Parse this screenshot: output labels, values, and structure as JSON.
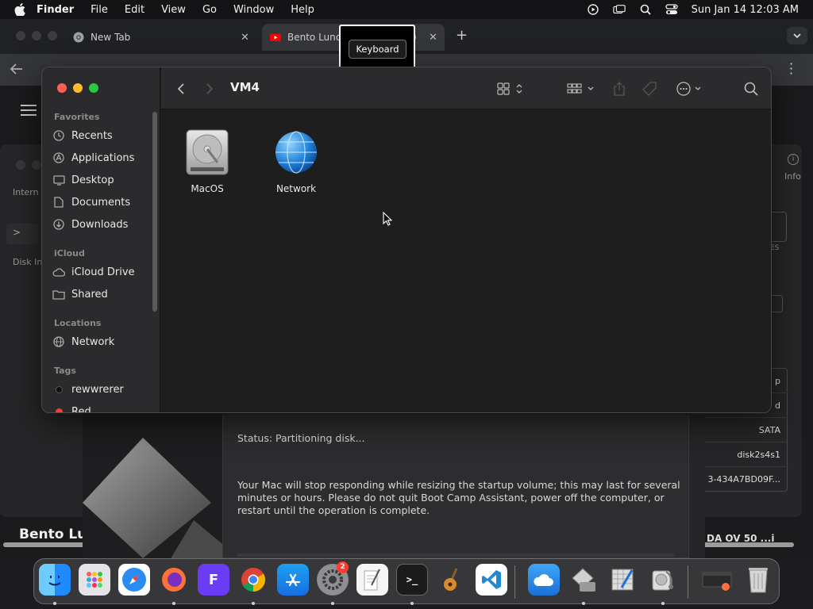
{
  "menubar": {
    "app": "Finder",
    "items": [
      "File",
      "Edit",
      "View",
      "Go",
      "Window",
      "Help"
    ],
    "clock": "Sun Jan 14  12:03 AM"
  },
  "browser": {
    "tabs": [
      {
        "title": "New Tab",
        "icon": "chrome-icon"
      },
      {
        "title": "Bento Lunc",
        "icon": "youtube-icon"
      }
    ],
    "tab_fragment": ")",
    "page_heading": "Bento Lu",
    "page_heading_right": "DA OV 50 ...i"
  },
  "keyboard_popup": {
    "label": "Keyboard"
  },
  "disk_utility": {
    "label_internal": "Intern",
    "label_disk": "Disk In",
    "info_label": "Info",
    "box_label": "ES",
    "rows": [
      "p",
      "d",
      "SATA",
      "disk2s4s1",
      "3-434A7BD09F..."
    ]
  },
  "bootcamp": {
    "status": "Status: Partitioning disk...",
    "message": "Your Mac will stop responding while resizing the startup volume; this may last for several minutes or hours. Please do not quit Boot Camp Assistant, power off the computer, or restart until the operation is complete."
  },
  "finder": {
    "title": "VM4",
    "sidebar": {
      "favorites_header": "Favorites",
      "favorites": [
        "Recents",
        "Applications",
        "Desktop",
        "Documents",
        "Downloads"
      ],
      "icloud_header": "iCloud",
      "icloud": [
        "iCloud Drive",
        "Shared"
      ],
      "locations_header": "Locations",
      "locations": [
        "Network"
      ],
      "tags_header": "Tags",
      "tags": [
        {
          "name": "rewwrerer",
          "color": "#1a1a1a"
        },
        {
          "name": "Red",
          "color": "#ff3b30"
        }
      ]
    },
    "items": [
      {
        "name": "MacOS",
        "icon": "hard-disk-icon"
      },
      {
        "name": "Network",
        "icon": "network-globe-icon"
      }
    ]
  },
  "dock": {
    "apps": [
      "Finder",
      "Launchpad",
      "Safari",
      "Firefox",
      "Fenix",
      "Chrome",
      "App Store",
      "System Settings",
      "TextEdit",
      "Terminal",
      "GarageBand",
      "Visual Studio Code",
      "Weather",
      "Boot Camp Assistant",
      "Script Editor",
      "Disk Utility",
      "Firefox Window",
      "Trash"
    ],
    "settings_badge": "2"
  }
}
